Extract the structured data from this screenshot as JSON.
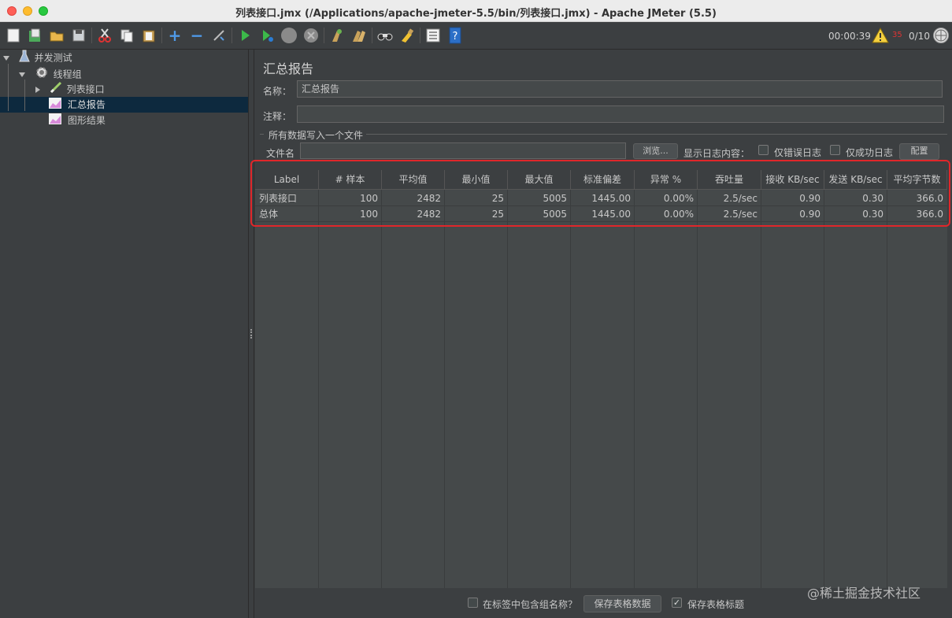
{
  "window": {
    "title": "列表接口.jmx (/Applications/apache-jmeter-5.5/bin/列表接口.jmx) - Apache JMeter (5.5)"
  },
  "toolbar": {
    "icons": [
      "new-icon",
      "templates-icon",
      "open-icon",
      "save-icon",
      "cut-icon",
      "copy-icon",
      "paste-icon",
      "expand-icon",
      "collapse-icon",
      "toggle-icon",
      "start-icon",
      "start-no-pause-icon",
      "stop-icon",
      "shutdown-icon",
      "clear-icon",
      "clear-all-icon",
      "search-icon",
      "reset-search-icon",
      "function-helper-icon",
      "help-icon"
    ],
    "timer": "00:00:39",
    "error_count": "35",
    "threads": "0/10"
  },
  "tree": {
    "items": [
      {
        "label": "并发测试",
        "icon": "test-plan-icon"
      },
      {
        "label": "线程组",
        "icon": "gear-icon"
      },
      {
        "label": "列表接口",
        "icon": "sampler-icon"
      },
      {
        "label": "汇总报告",
        "icon": "chart-icon"
      },
      {
        "label": "图形结果",
        "icon": "chart-icon"
      }
    ],
    "selected": "汇总报告"
  },
  "panel": {
    "title": "汇总报告",
    "name_label": "名称：",
    "name_value": "汇总报告",
    "comment_label": "注释：",
    "comment_value": "",
    "file_group_label": "所有数据写入一个文件",
    "filename_label": "文件名",
    "filename_value": "",
    "browse_label": "浏览...",
    "log_content_label": "显示日志内容：",
    "errors_only_label": "仅错误日志",
    "success_only_label": "仅成功日志",
    "configure_label": "配置"
  },
  "table": {
    "headers": [
      "Label",
      "# 样本",
      "平均值",
      "最小值",
      "最大值",
      "标准偏差",
      "异常 %",
      "吞吐量",
      "接收 KB/sec",
      "发送 KB/sec",
      "平均字节数"
    ],
    "rows": [
      [
        "列表接口",
        "100",
        "2482",
        "25",
        "5005",
        "1445.00",
        "0.00%",
        "2.5/sec",
        "0.90",
        "0.30",
        "366.0"
      ],
      [
        "总体",
        "100",
        "2482",
        "25",
        "5005",
        "1445.00",
        "0.00%",
        "2.5/sec",
        "0.90",
        "0.30",
        "366.0"
      ]
    ]
  },
  "footer": {
    "include_group_label": "在标签中包含组名称？",
    "save_table_label": "保存表格数据",
    "save_header_label": "保存表格标题",
    "include_group_checked": false,
    "save_header_checked": true
  },
  "watermark": "@稀土掘金技术社区",
  "colors": {
    "background": "#3c3f41",
    "selection": "#0d293e",
    "highlight_box": "#e0262a"
  }
}
